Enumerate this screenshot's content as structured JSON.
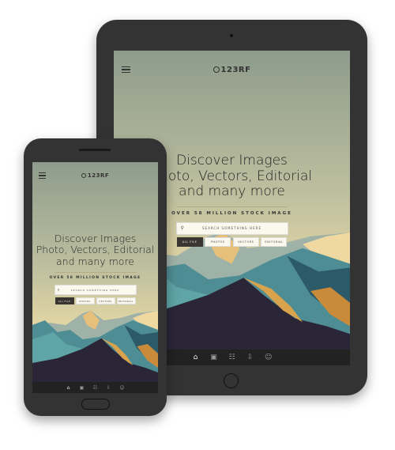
{
  "app": {
    "logo_text": "123RF",
    "title_lines": [
      "Discover Images",
      "Photo, Vectors, Editorial",
      "and many more"
    ],
    "tagline": "OVER 58 MILLION STOCK IMAGE",
    "search_placeholder": "SEARCH SOMETHING HERE",
    "filters": [
      {
        "label": "ALL FILE",
        "active": true
      },
      {
        "label": "PHOTOS",
        "active": false
      },
      {
        "label": "VECTORS",
        "active": false
      },
      {
        "label": "EDITORIAL",
        "active": false
      }
    ],
    "nav_icons": [
      "home-icon",
      "gallery-icon",
      "cart-icon",
      "download-icon",
      "user-icon"
    ],
    "active_nav": "home-icon"
  },
  "colors": {
    "device": "#333333",
    "accent_dark": "#3a3530",
    "nav_bg": "#222222"
  }
}
